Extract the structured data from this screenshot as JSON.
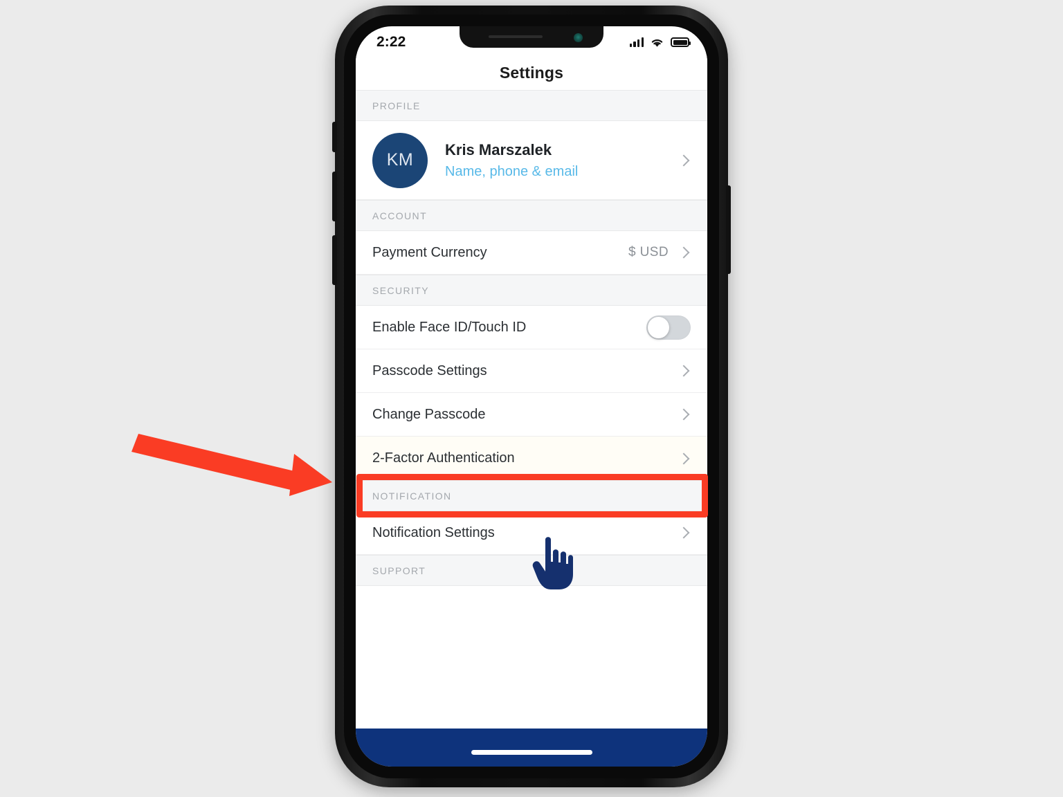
{
  "status_bar": {
    "time": "2:22",
    "signal_icon": "cellular-signal-icon",
    "wifi_icon": "wifi-icon",
    "battery_icon": "battery-full-icon"
  },
  "nav": {
    "title": "Settings"
  },
  "sections": [
    {
      "header": "PROFILE",
      "rows": [
        {
          "type": "profile",
          "avatar_initials": "KM",
          "name": "Kris Marszalek",
          "subtitle": "Name, phone & email",
          "accessory": "chevron-right-icon"
        }
      ]
    },
    {
      "header": "ACCOUNT",
      "rows": [
        {
          "type": "value",
          "label": "Payment Currency",
          "value": "$ USD",
          "accessory": "chevron-right-icon"
        }
      ]
    },
    {
      "header": "SECURITY",
      "rows": [
        {
          "type": "toggle",
          "label": "Enable Face ID/Touch ID",
          "toggle_state": "off"
        },
        {
          "type": "link",
          "label": "Passcode Settings",
          "accessory": "chevron-right-icon"
        },
        {
          "type": "link",
          "label": "Change Passcode",
          "accessory": "chevron-right-icon"
        },
        {
          "type": "link",
          "label": "2-Factor Authentication",
          "accessory": "chevron-right-icon",
          "highlighted": true
        }
      ]
    },
    {
      "header": "NOTIFICATION",
      "rows": [
        {
          "type": "link",
          "label": "Notification Settings",
          "accessory": "chevron-right-icon"
        }
      ]
    },
    {
      "header": "SUPPORT",
      "rows": []
    }
  ],
  "annotations": {
    "arrow_color": "#fa3c24",
    "highlight_color": "#fa3c24",
    "cursor_icon": "pointing-hand-cursor",
    "cursor_color": "#15306e"
  },
  "colors": {
    "page_background": "#ebebeb",
    "screen_background": "#ffffff",
    "section_header_background": "#f5f6f7",
    "avatar_background": "#1b4576",
    "profile_subtitle": "#58b9e8",
    "bottom_bar": "#0e337c"
  }
}
